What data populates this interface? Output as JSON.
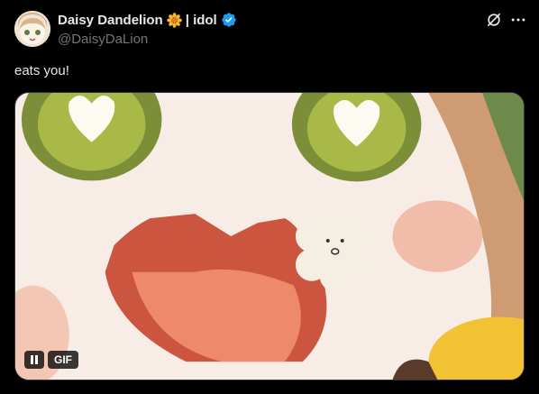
{
  "post": {
    "author": {
      "display_name": "Daisy Dandelion",
      "name_suffix": "| idol",
      "handle": "@DaisyDaLion",
      "verified": true,
      "emoji": "sunflower-icon"
    },
    "text": "eats you!",
    "media": {
      "type": "gif",
      "badge": "GIF",
      "playing": true
    }
  },
  "colors": {
    "background": "#000000",
    "text_primary": "#e7e9ea",
    "text_secondary": "#71767b",
    "verified_blue": "#1d9bf0"
  }
}
